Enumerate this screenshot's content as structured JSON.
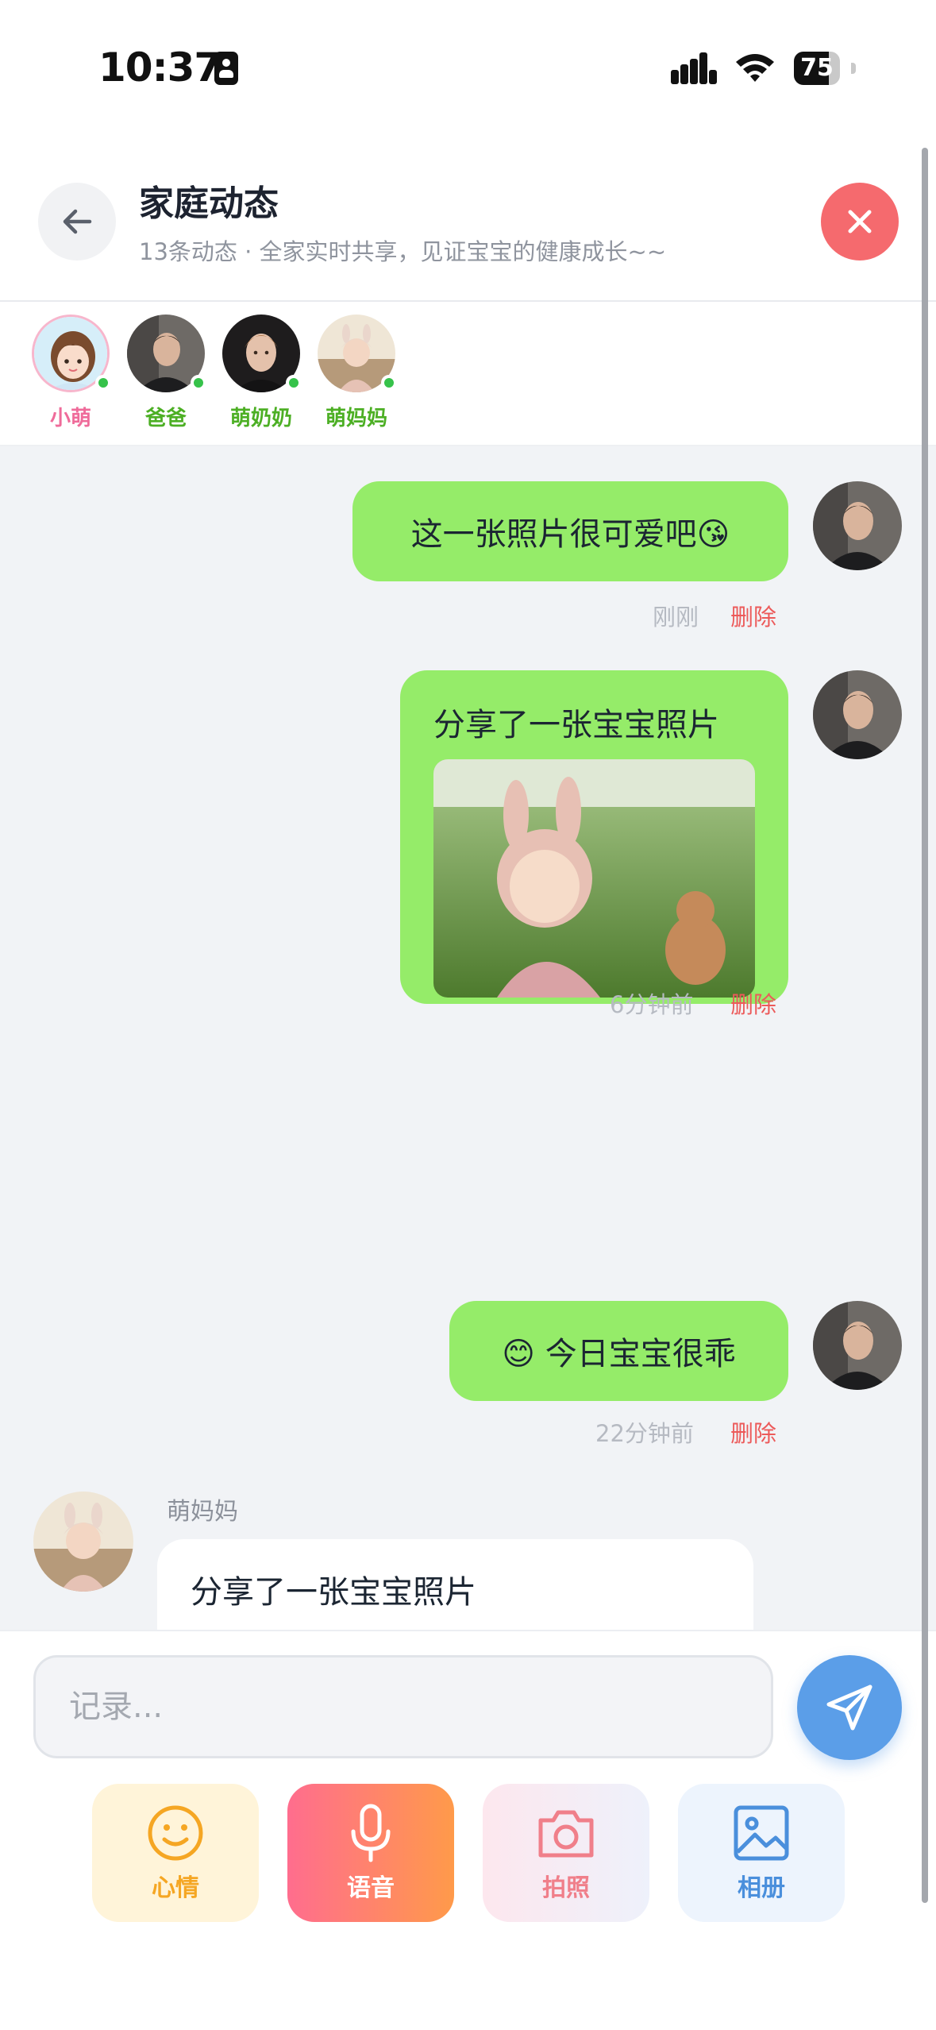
{
  "status_bar": {
    "time": "10:37",
    "battery": "75",
    "battery_level": 0.75
  },
  "header": {
    "title": "家庭动态",
    "subtitle": "13条动态 · 全家实时共享，见证宝宝的健康成长~~"
  },
  "members": [
    {
      "name": "小萌",
      "color": "#ef6b9a",
      "online": true
    },
    {
      "name": "爸爸",
      "color": "#4caf24",
      "online": true
    },
    {
      "name": "萌奶奶",
      "color": "#4caf24",
      "online": true
    },
    {
      "name": "萌妈妈",
      "color": "#4caf24",
      "online": true
    }
  ],
  "messages": [
    {
      "text": "这一张照片很可爱吧😘",
      "time": "刚刚",
      "delete": "删除"
    },
    {
      "text": "分享了一张宝宝照片",
      "time": "6分钟前",
      "delete": "删除"
    },
    {
      "text": "😊 今日宝宝很乖",
      "time": "22分钟前",
      "delete": "删除"
    },
    {
      "sender": "萌妈妈",
      "text": "分享了一张宝宝照片"
    }
  ],
  "composer": {
    "placeholder": "记录..."
  },
  "tools": [
    {
      "label": "心情",
      "icon": "smile-icon",
      "color": "#f5a623"
    },
    {
      "label": "语音",
      "icon": "microphone-icon",
      "color": "#ffffff"
    },
    {
      "label": "拍照",
      "icon": "camera-icon",
      "color": "#f07f8a"
    },
    {
      "label": "相册",
      "icon": "image-icon",
      "color": "#4a8fdc"
    }
  ],
  "colors": {
    "bubble_out": "#95ec69",
    "accent_red": "#f56a6e",
    "send_blue": "#5b9ee8"
  }
}
